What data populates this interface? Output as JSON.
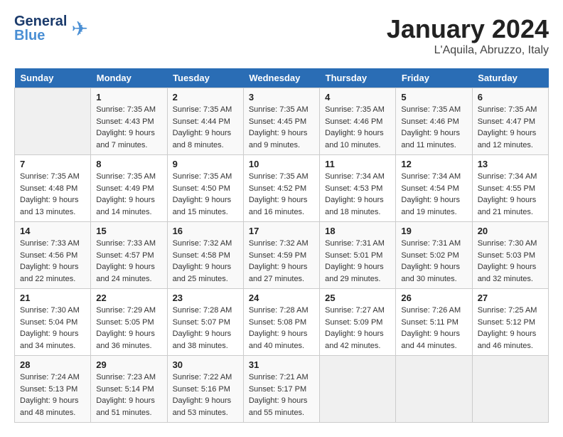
{
  "header": {
    "logo_line1": "General",
    "logo_line2": "Blue",
    "month_title": "January 2024",
    "location": "L'Aquila, Abruzzo, Italy"
  },
  "days_of_week": [
    "Sunday",
    "Monday",
    "Tuesday",
    "Wednesday",
    "Thursday",
    "Friday",
    "Saturday"
  ],
  "weeks": [
    [
      {
        "day": "",
        "info": ""
      },
      {
        "day": "1",
        "info": "Sunrise: 7:35 AM\nSunset: 4:43 PM\nDaylight: 9 hours\nand 7 minutes."
      },
      {
        "day": "2",
        "info": "Sunrise: 7:35 AM\nSunset: 4:44 PM\nDaylight: 9 hours\nand 8 minutes."
      },
      {
        "day": "3",
        "info": "Sunrise: 7:35 AM\nSunset: 4:45 PM\nDaylight: 9 hours\nand 9 minutes."
      },
      {
        "day": "4",
        "info": "Sunrise: 7:35 AM\nSunset: 4:46 PM\nDaylight: 9 hours\nand 10 minutes."
      },
      {
        "day": "5",
        "info": "Sunrise: 7:35 AM\nSunset: 4:46 PM\nDaylight: 9 hours\nand 11 minutes."
      },
      {
        "day": "6",
        "info": "Sunrise: 7:35 AM\nSunset: 4:47 PM\nDaylight: 9 hours\nand 12 minutes."
      }
    ],
    [
      {
        "day": "7",
        "info": "Sunrise: 7:35 AM\nSunset: 4:48 PM\nDaylight: 9 hours\nand 13 minutes."
      },
      {
        "day": "8",
        "info": "Sunrise: 7:35 AM\nSunset: 4:49 PM\nDaylight: 9 hours\nand 14 minutes."
      },
      {
        "day": "9",
        "info": "Sunrise: 7:35 AM\nSunset: 4:50 PM\nDaylight: 9 hours\nand 15 minutes."
      },
      {
        "day": "10",
        "info": "Sunrise: 7:35 AM\nSunset: 4:52 PM\nDaylight: 9 hours\nand 16 minutes."
      },
      {
        "day": "11",
        "info": "Sunrise: 7:34 AM\nSunset: 4:53 PM\nDaylight: 9 hours\nand 18 minutes."
      },
      {
        "day": "12",
        "info": "Sunrise: 7:34 AM\nSunset: 4:54 PM\nDaylight: 9 hours\nand 19 minutes."
      },
      {
        "day": "13",
        "info": "Sunrise: 7:34 AM\nSunset: 4:55 PM\nDaylight: 9 hours\nand 21 minutes."
      }
    ],
    [
      {
        "day": "14",
        "info": "Sunrise: 7:33 AM\nSunset: 4:56 PM\nDaylight: 9 hours\nand 22 minutes."
      },
      {
        "day": "15",
        "info": "Sunrise: 7:33 AM\nSunset: 4:57 PM\nDaylight: 9 hours\nand 24 minutes."
      },
      {
        "day": "16",
        "info": "Sunrise: 7:32 AM\nSunset: 4:58 PM\nDaylight: 9 hours\nand 25 minutes."
      },
      {
        "day": "17",
        "info": "Sunrise: 7:32 AM\nSunset: 4:59 PM\nDaylight: 9 hours\nand 27 minutes."
      },
      {
        "day": "18",
        "info": "Sunrise: 7:31 AM\nSunset: 5:01 PM\nDaylight: 9 hours\nand 29 minutes."
      },
      {
        "day": "19",
        "info": "Sunrise: 7:31 AM\nSunset: 5:02 PM\nDaylight: 9 hours\nand 30 minutes."
      },
      {
        "day": "20",
        "info": "Sunrise: 7:30 AM\nSunset: 5:03 PM\nDaylight: 9 hours\nand 32 minutes."
      }
    ],
    [
      {
        "day": "21",
        "info": "Sunrise: 7:30 AM\nSunset: 5:04 PM\nDaylight: 9 hours\nand 34 minutes."
      },
      {
        "day": "22",
        "info": "Sunrise: 7:29 AM\nSunset: 5:05 PM\nDaylight: 9 hours\nand 36 minutes."
      },
      {
        "day": "23",
        "info": "Sunrise: 7:28 AM\nSunset: 5:07 PM\nDaylight: 9 hours\nand 38 minutes."
      },
      {
        "day": "24",
        "info": "Sunrise: 7:28 AM\nSunset: 5:08 PM\nDaylight: 9 hours\nand 40 minutes."
      },
      {
        "day": "25",
        "info": "Sunrise: 7:27 AM\nSunset: 5:09 PM\nDaylight: 9 hours\nand 42 minutes."
      },
      {
        "day": "26",
        "info": "Sunrise: 7:26 AM\nSunset: 5:11 PM\nDaylight: 9 hours\nand 44 minutes."
      },
      {
        "day": "27",
        "info": "Sunrise: 7:25 AM\nSunset: 5:12 PM\nDaylight: 9 hours\nand 46 minutes."
      }
    ],
    [
      {
        "day": "28",
        "info": "Sunrise: 7:24 AM\nSunset: 5:13 PM\nDaylight: 9 hours\nand 48 minutes."
      },
      {
        "day": "29",
        "info": "Sunrise: 7:23 AM\nSunset: 5:14 PM\nDaylight: 9 hours\nand 51 minutes."
      },
      {
        "day": "30",
        "info": "Sunrise: 7:22 AM\nSunset: 5:16 PM\nDaylight: 9 hours\nand 53 minutes."
      },
      {
        "day": "31",
        "info": "Sunrise: 7:21 AM\nSunset: 5:17 PM\nDaylight: 9 hours\nand 55 minutes."
      },
      {
        "day": "",
        "info": ""
      },
      {
        "day": "",
        "info": ""
      },
      {
        "day": "",
        "info": ""
      }
    ]
  ]
}
